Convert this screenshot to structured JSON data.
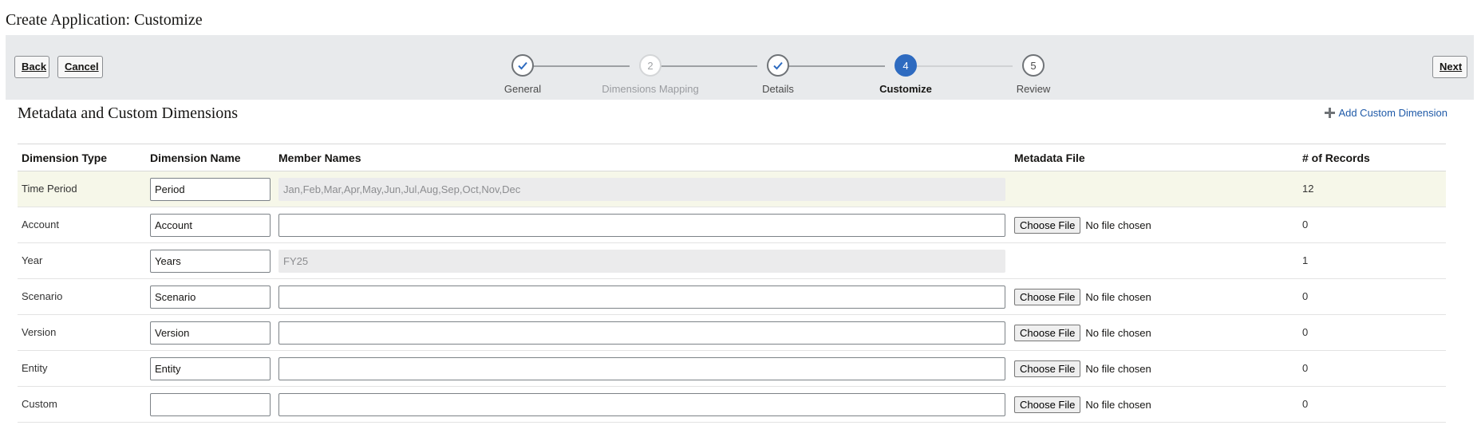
{
  "page": {
    "title": "Create Application: Customize"
  },
  "toolbar": {
    "back_label": "Back",
    "cancel_label": "Cancel",
    "next_label": "Next"
  },
  "train": {
    "steps": [
      {
        "number": "1",
        "label": "General",
        "state": "done"
      },
      {
        "number": "2",
        "label": "Dimensions Mapping",
        "state": "pending"
      },
      {
        "number": "3",
        "label": "Details",
        "state": "done"
      },
      {
        "number": "4",
        "label": "Customize",
        "state": "current"
      },
      {
        "number": "5",
        "label": "Review",
        "state": "todo"
      }
    ]
  },
  "section": {
    "title": "Metadata and Custom Dimensions",
    "add_label": "Add Custom Dimension"
  },
  "table": {
    "headers": {
      "type": "Dimension Type",
      "name": "Dimension Name",
      "members": "Member Names",
      "file": "Metadata File",
      "records": "# of Records"
    },
    "choose_file_label": "Choose File",
    "no_file_text": "No file chosen",
    "rows": [
      {
        "type": "Time Period",
        "name": "Period",
        "members": "Jan,Feb,Mar,Apr,May,Jun,Jul,Aug,Sep,Oct,Nov,Dec",
        "members_readonly": true,
        "has_file": false,
        "records": "12"
      },
      {
        "type": "Account",
        "name": "Account",
        "members": "",
        "members_readonly": false,
        "has_file": true,
        "records": "0"
      },
      {
        "type": "Year",
        "name": "Years",
        "members": "FY25",
        "members_readonly": true,
        "has_file": false,
        "records": "1"
      },
      {
        "type": "Scenario",
        "name": "Scenario",
        "members": "",
        "members_readonly": false,
        "has_file": true,
        "records": "0"
      },
      {
        "type": "Version",
        "name": "Version",
        "members": "",
        "members_readonly": false,
        "has_file": true,
        "records": "0"
      },
      {
        "type": "Entity",
        "name": "Entity",
        "members": "",
        "members_readonly": false,
        "has_file": true,
        "records": "0"
      },
      {
        "type": "Custom",
        "name": "",
        "members": "",
        "members_readonly": false,
        "has_file": true,
        "records": "0"
      }
    ]
  },
  "colors": {
    "accent": "#2e6bc0",
    "link": "#1f5aa8",
    "train_background": "#e8eaec",
    "highlight_row": "#f6f7e9"
  }
}
